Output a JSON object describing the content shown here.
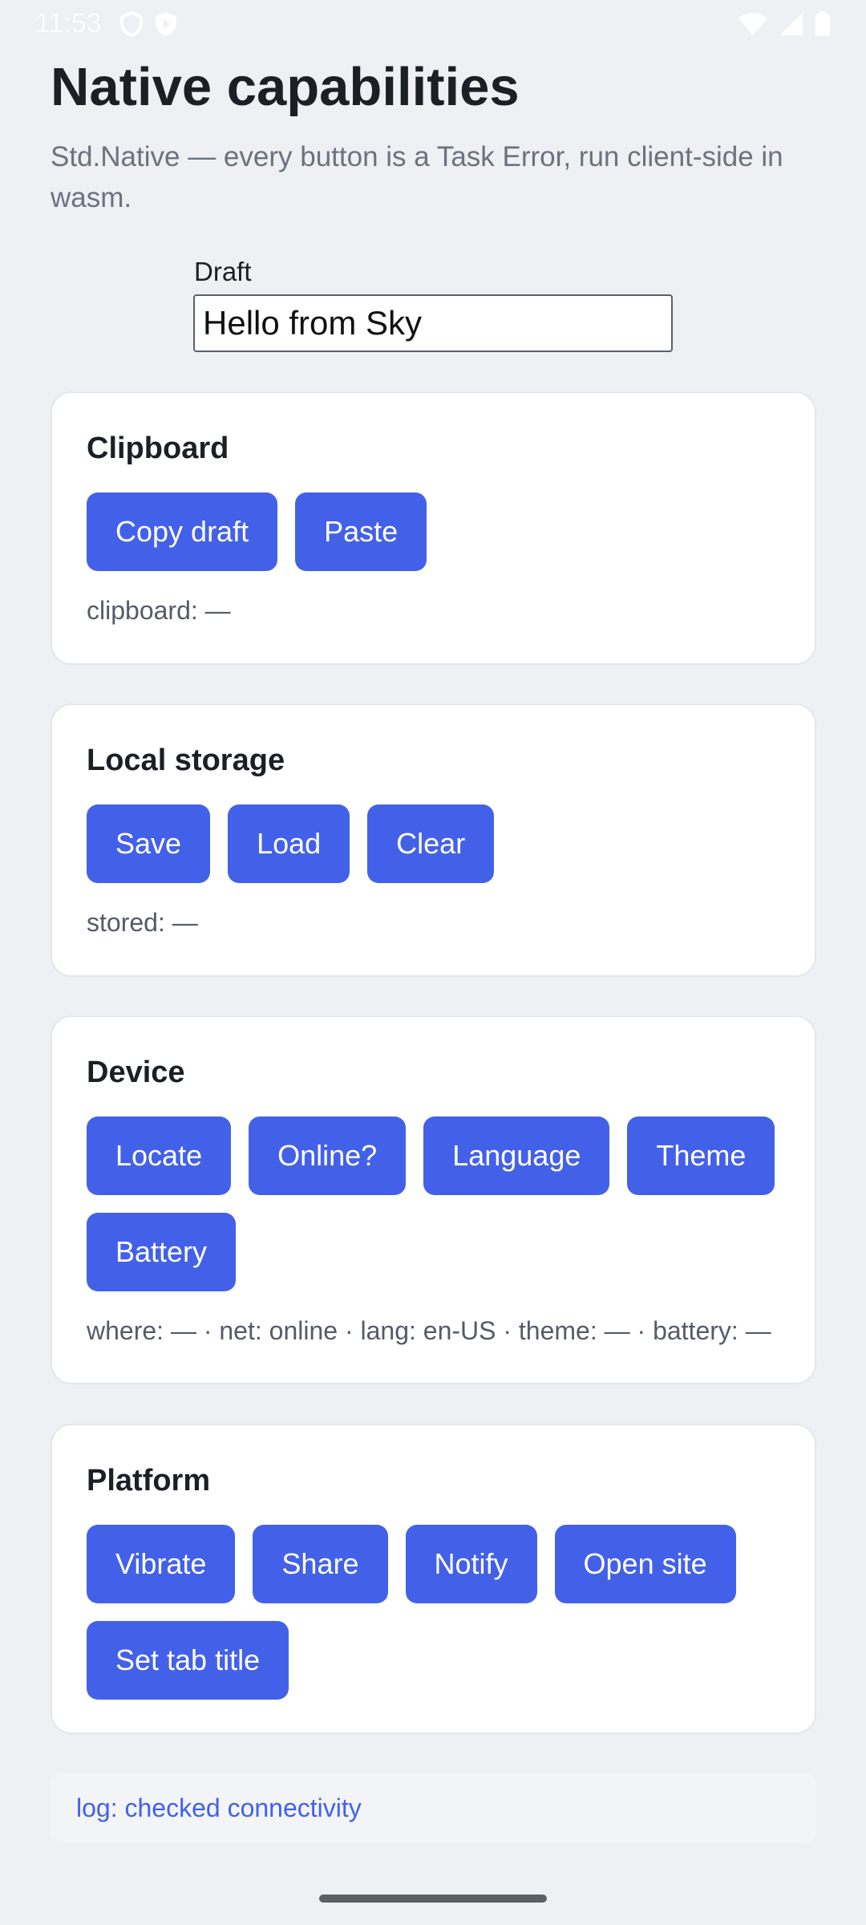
{
  "status_bar": {
    "time": "11:53"
  },
  "header": {
    "title": "Native capabilities",
    "subtitle": "Std.Native — every button is a Task Error, run client-side in wasm."
  },
  "draft": {
    "label": "Draft",
    "value": "Hello from Sky"
  },
  "cards": {
    "clipboard": {
      "title": "Clipboard",
      "buttons": [
        "Copy draft",
        "Paste"
      ],
      "status": "clipboard: —"
    },
    "storage": {
      "title": "Local storage",
      "buttons": [
        "Save",
        "Load",
        "Clear"
      ],
      "status": "stored: —"
    },
    "device": {
      "title": "Device",
      "buttons": [
        "Locate",
        "Online?",
        "Language",
        "Theme",
        "Battery"
      ],
      "status": "where: — · net: online · lang: en-US · theme: — · battery: —"
    },
    "platform": {
      "title": "Platform",
      "buttons": [
        "Vibrate",
        "Share",
        "Notify",
        "Open site",
        "Set tab title"
      ]
    }
  },
  "log": {
    "text": "log: checked connectivity"
  },
  "colors": {
    "accent": "#4361e8",
    "background": "#eef0f4",
    "card": "#ffffff"
  }
}
